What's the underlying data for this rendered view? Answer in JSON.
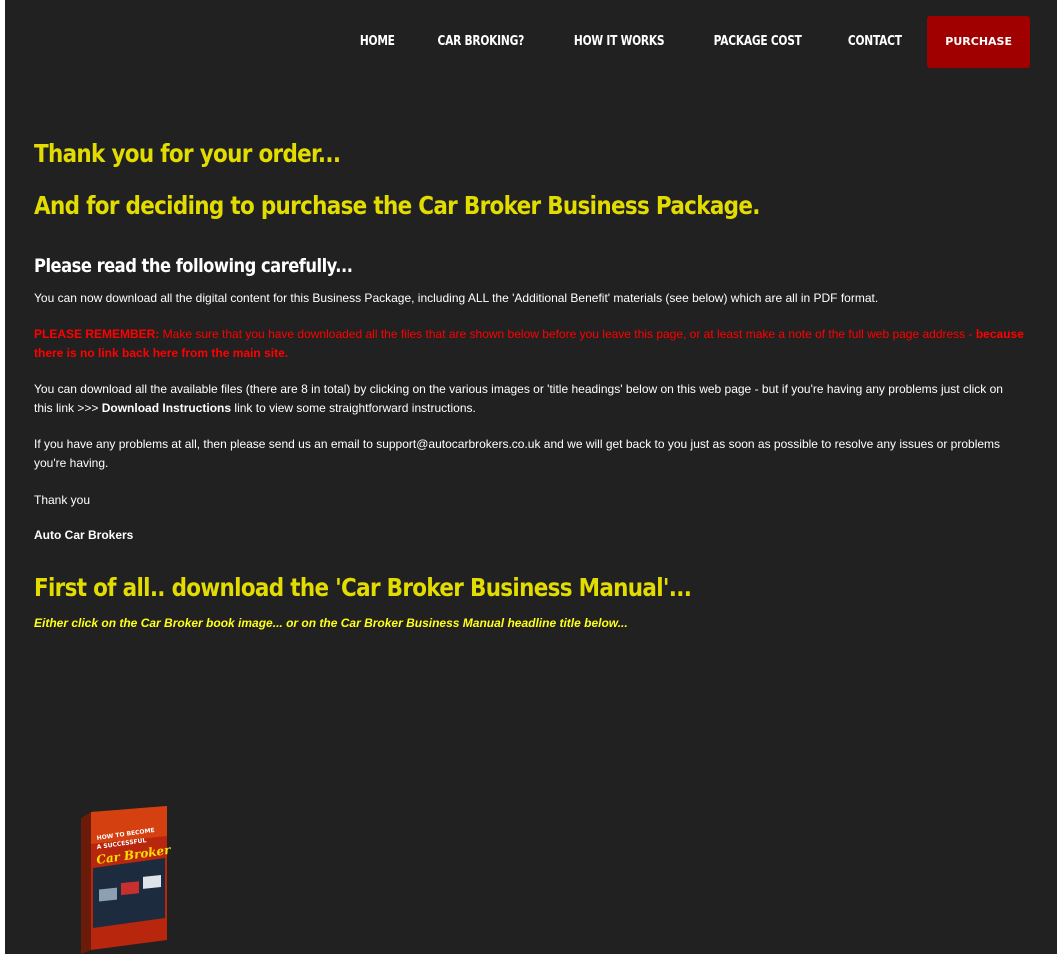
{
  "nav": {
    "items": [
      "HOME",
      "CAR BROKING?",
      "HOW IT WORKS",
      "PACKAGE COST",
      "CONTACT"
    ],
    "purchase_label": "PURCHASE"
  },
  "colors": {
    "background": "#212121",
    "heading_yellow": "#e3dc00",
    "warning_red": "#ff0000",
    "purchase_button": "#a00000"
  },
  "main": {
    "heading1": "Thank you for your order...",
    "heading2": "And for deciding to purchase the Car Broker Business Package.",
    "subheading": "Please read the following carefully...",
    "para1": "You can now download all the digital content for this Business Package, including ALL the 'Additional Benefit' materials (see below) which are all in PDF format.",
    "remember_label": "PLEASE REMEMBER:",
    "remember_text": " Make sure that you have downloaded all the files that are shown below before you leave this page, or at least make a note of the full web page address - ",
    "remember_bold": "because there is no link back here from the main site.",
    "para3_before": "You can download all the available files (there are 8 in total) by clicking on the various images or 'title headings' below on this web page - but if you're having any problems just click on this link >>> ",
    "para3_link": "Download Instructions",
    "para3_after": " link to view some straightforward instructions.",
    "para4": "If you have any problems at all, then please send us an email to support@autocarbrokers.co.uk and we will get back to you just as soon as possible to resolve any issues or problems you're having.",
    "thanks": "Thank you",
    "signature": "Auto Car Brokers",
    "manual_heading": "First of all.. download the 'Car Broker Business Manual'...",
    "manual_instruction": "Either click on the Car Broker book image... or on the Car Broker Business Manual headline title below..."
  },
  "book": {
    "icon": "book-cover-icon",
    "title_line1": "HOW TO BECOME",
    "title_line2": "A SUCCESSFUL",
    "title_line3": "Car Broker"
  }
}
